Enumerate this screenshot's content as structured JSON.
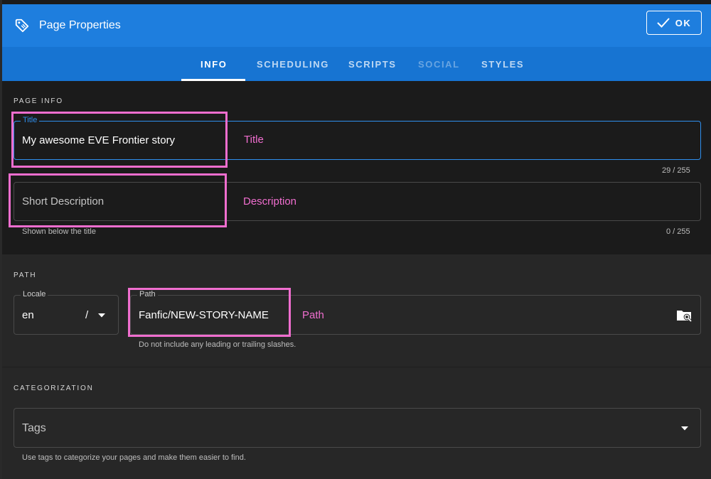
{
  "header": {
    "title": "Page Properties",
    "ok_label": "OK"
  },
  "tabs": [
    {
      "label": "INFO",
      "state": "active"
    },
    {
      "label": "SCHEDULING",
      "state": "normal"
    },
    {
      "label": "SCRIPTS",
      "state": "normal"
    },
    {
      "label": "SOCIAL",
      "state": "disabled"
    },
    {
      "label": "STYLES",
      "state": "normal"
    }
  ],
  "page_info": {
    "section_label": "PAGE INFO",
    "title_field": {
      "legend": "Title",
      "value": "My awesome EVE Frontier story",
      "counter": "29 / 255"
    },
    "description_field": {
      "placeholder": "Short Description",
      "hint": "Shown below the title",
      "counter": "0 / 255"
    }
  },
  "path_section": {
    "section_label": "PATH",
    "locale": {
      "legend": "Locale",
      "value": "en",
      "separator": "/"
    },
    "path": {
      "legend": "Path",
      "value": "Fanfic/NEW-STORY-NAME",
      "hint": "Do not include any leading or trailing slashes."
    }
  },
  "categorization": {
    "section_label": "CATEGORIZATION",
    "tags": {
      "placeholder": "Tags",
      "hint": "Use tags to categorize your pages and make them easier to find."
    }
  },
  "annotations": {
    "title": "Title",
    "description": "Description",
    "path": "Path"
  },
  "colors": {
    "header_blue": "#1e7ede",
    "tabs_blue": "#1774d2",
    "focus_blue": "#2f8fee",
    "annotation_pink": "#f06ecf"
  },
  "icons": {
    "header": "tag-icon",
    "ok": "check-icon",
    "locale_dropdown": "caret-down-icon",
    "path_browse": "folder-search-icon",
    "tags_dropdown": "caret-down-icon"
  }
}
